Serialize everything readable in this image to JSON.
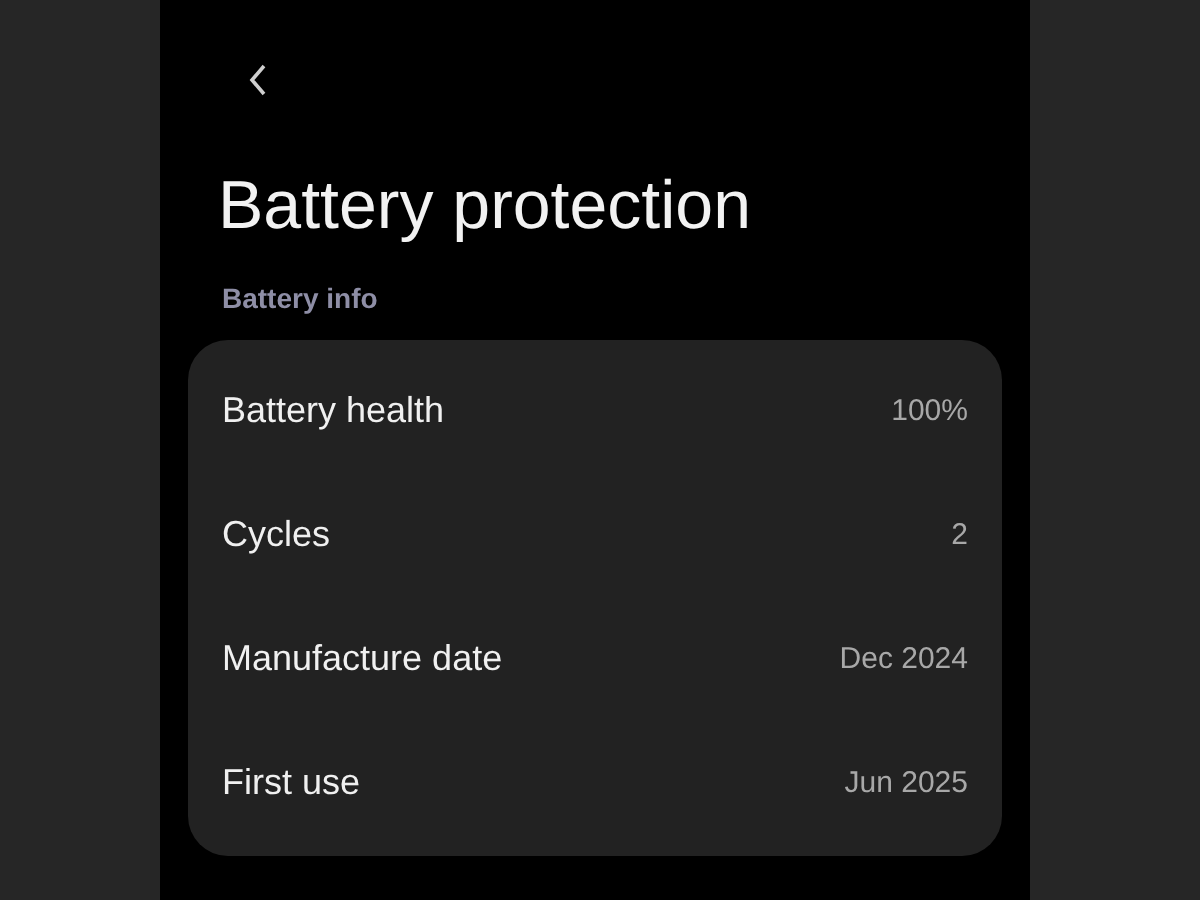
{
  "header": {
    "title": "Battery protection"
  },
  "section": {
    "label": "Battery info",
    "rows": [
      {
        "label": "Battery health",
        "value": "100%"
      },
      {
        "label": "Cycles",
        "value": "2"
      },
      {
        "label": "Manufacture date",
        "value": "Dec 2024"
      },
      {
        "label": "First use",
        "value": "Jun 2025"
      }
    ]
  }
}
